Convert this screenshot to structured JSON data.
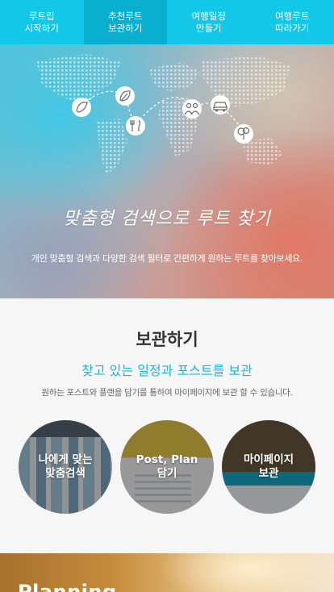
{
  "nav": {
    "tabs": [
      {
        "label": "루트립\n시작하기"
      },
      {
        "label": "추천루트\n보관하기"
      },
      {
        "label": "여행일정\n만들기"
      },
      {
        "label": "여행루트\n따라가기"
      }
    ],
    "active_index": 1
  },
  "hero": {
    "title": "맞춤형 검색으로 루트 찾기",
    "subtitle": "개인 맞춤형 검색과 다양한 검색 필터로 간편하게 원하는 루트를 찾아보세요.",
    "map_icons": [
      "leaf-person-icon",
      "leaf-icon",
      "dining-icon",
      "people-icon",
      "car-icon",
      "tree-icon"
    ]
  },
  "storage": {
    "title": "보관하기",
    "subtitle": "찾고 있는 일정과 포스트를 보관",
    "description": "원하는 포스트와 플랜을 담기를 통하여 마이페이지에 보관 할 수 있습니다.",
    "items": [
      {
        "label": "나에게 맞는\n맞춤검색"
      },
      {
        "label": "Post, Plan\n담기"
      },
      {
        "label": "마이페이지\n보관"
      }
    ]
  },
  "planning": {
    "title": "Planning"
  },
  "colors": {
    "nav_bg": "#12c7e8",
    "nav_active": "#0aaecf",
    "accent": "#17b8df"
  }
}
